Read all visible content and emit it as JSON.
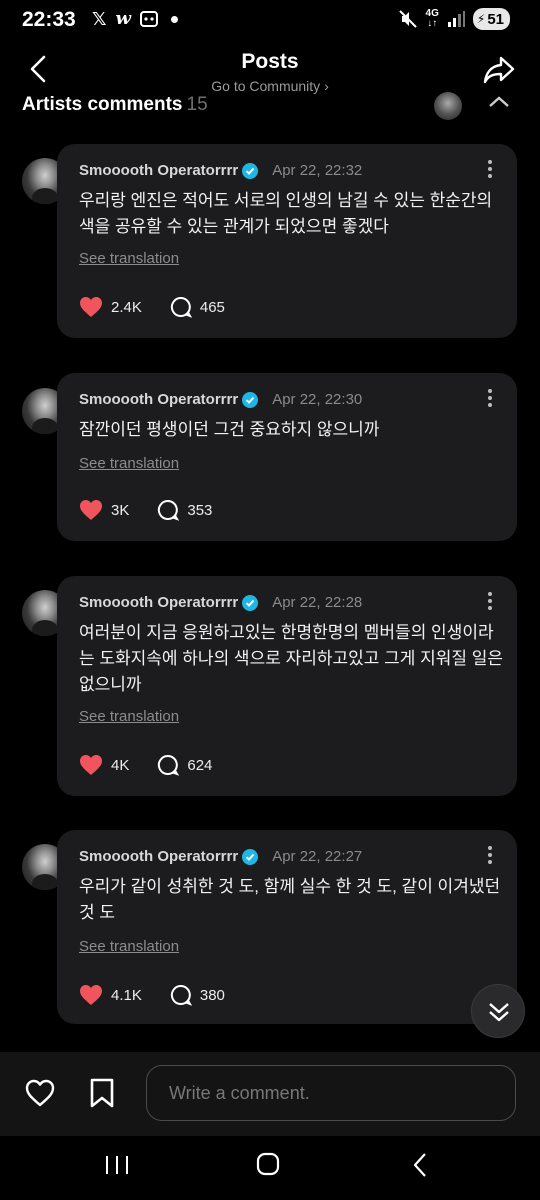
{
  "status_bar": {
    "time": "22:33",
    "left_icons": [
      "x-icon",
      "w-icon",
      "gallery-icon"
    ],
    "network": "4G",
    "battery": "51"
  },
  "header": {
    "title": "Posts",
    "subtitle": "Go to Community",
    "subtitle_chevron": "›"
  },
  "section": {
    "title": "Artists comments",
    "count": "15"
  },
  "comments": [
    {
      "author": "Smooooth Operatorrrr",
      "date": "Apr 22, 22:32",
      "text": "우리랑 엔진은 적어도 서로의 인생의 남길 수 있는 한순간의 색을 공유할 수 있는 관계가 되었으면 좋겠다",
      "translate": "See translation",
      "likes": "2.4K",
      "replies": "465"
    },
    {
      "author": "Smooooth Operatorrrr",
      "date": "Apr 22, 22:30",
      "text": "잠깐이던 평생이던 그건 중요하지 않으니까",
      "translate": "See translation",
      "likes": "3K",
      "replies": "353"
    },
    {
      "author": "Smooooth Operatorrrr",
      "date": "Apr 22, 22:28",
      "text": "여러분이 지금 응원하고있는 한명한명의 멤버들의 인생이라는 도화지속에 하나의 색으로 자리하고있고 그게 지워질 일은 없으니까",
      "translate": "See translation",
      "likes": "4K",
      "replies": "624"
    },
    {
      "author": "Smooooth Operatorrrr",
      "date": "Apr 22, 22:27",
      "text": "우리가 같이 성취한 것 도, 함께 실수 한 것 도, 같이 이겨냈던 것 도",
      "translate": "See translation",
      "likes": "4.1K",
      "replies": "380"
    }
  ],
  "composer": {
    "placeholder": "Write a comment."
  },
  "colors": {
    "background": "#000000",
    "bubble": "#1c1c1e",
    "heart": "#f0555e",
    "verified": "#1fb6e6",
    "muted": "#8a8a8a"
  }
}
